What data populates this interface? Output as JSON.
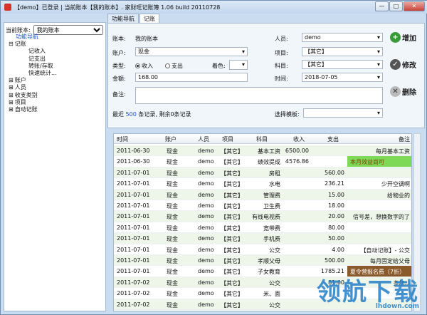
{
  "title": "【demo】已登录 | 当前账本【我的账本】. 家财旺记账簿 1.06 build 20110728",
  "window_buttons": {
    "min": "—",
    "max": "□",
    "close": "✕"
  },
  "left": {
    "acct_label": "当前账本:",
    "acct_value": "我的账本",
    "tree": [
      {
        "label": "功能导航",
        "level": 0,
        "selected": true,
        "toggle": ""
      },
      {
        "label": "记账",
        "level": 0,
        "toggle": "⊟"
      },
      {
        "label": "记收入",
        "level": 1
      },
      {
        "label": "记支出",
        "level": 1
      },
      {
        "label": "转账/存取",
        "level": 1
      },
      {
        "label": "快速统计...",
        "level": 1
      },
      {
        "label": "账户",
        "level": 0,
        "toggle": "⊞"
      },
      {
        "label": "人员",
        "level": 0,
        "toggle": "⊞"
      },
      {
        "label": "收支类别",
        "level": 0,
        "toggle": "⊞"
      },
      {
        "label": "项目",
        "level": 0,
        "toggle": "⊞"
      },
      {
        "label": "自动记账",
        "level": 0,
        "toggle": "⊞"
      }
    ]
  },
  "tabs": [
    "功能导航",
    "记账"
  ],
  "form": {
    "book_label": "账本:",
    "book_value": "我的账本",
    "account_label": "账户:",
    "account_value": "现金",
    "type_label": "类型:",
    "type_income": "收入",
    "type_expense": "支出",
    "color_label": "着色:",
    "amount_label": "金额:",
    "amount_value": "168.00",
    "note_label": "备注:",
    "person_label": "人员:",
    "person_value": "demo",
    "project_label": "项目:",
    "project_value": "【其它】",
    "subject_label": "科目:",
    "subject_value": "【其它】",
    "time_label": "时间:",
    "time_value": "2018-07-05",
    "recent_prefix": "最近",
    "recent_count": "500",
    "recent_suffix": "条记录, 剩余0条记录",
    "template_label": "选择模板:"
  },
  "actions": {
    "add": "增加",
    "edit": "修改",
    "delete": "删除"
  },
  "table": {
    "headers": [
      "时间",
      "账户",
      "人员",
      "项目",
      "科目",
      "收入",
      "支出",
      "备注"
    ],
    "rows": [
      [
        "2011-06-30",
        "现金",
        "demo",
        "【其它】",
        "基本工资",
        "6500.00",
        "",
        "每月基本工资"
      ],
      [
        "2011-06-30",
        "现金",
        "demo",
        "【其它】",
        "绩效提成",
        "4576.86",
        "",
        "本月效益尚可"
      ],
      [
        "2011-07-01",
        "现金",
        "demo",
        "【其它】",
        "房租",
        "",
        "560.00",
        ""
      ],
      [
        "2011-07-01",
        "现金",
        "demo",
        "【其它】",
        "水电",
        "",
        "236.21",
        "少开空调啊"
      ],
      [
        "2011-07-01",
        "现金",
        "demo",
        "【其它】",
        "管理费",
        "",
        "15.00",
        "给物业的"
      ],
      [
        "2011-07-01",
        "现金",
        "demo",
        "【其它】",
        "卫生费",
        "",
        "18.00",
        ""
      ],
      [
        "2011-07-01",
        "现金",
        "demo",
        "【其它】",
        "有线电视费",
        "",
        "20.00",
        "信号差，想换数字的了"
      ],
      [
        "2011-07-01",
        "现金",
        "demo",
        "【其它】",
        "宽带费",
        "",
        "80.00",
        ""
      ],
      [
        "2011-07-01",
        "现金",
        "demo",
        "【其它】",
        "手机费",
        "",
        "50.00",
        ""
      ],
      [
        "2011-07-01",
        "现金",
        "demo",
        "【其它】",
        "公交",
        "",
        "4.00",
        "【自动记账】- 公交"
      ],
      [
        "2011-07-01",
        "现金",
        "demo",
        "【其它】",
        "孝顺父母",
        "",
        "500.00",
        "每月固定给父母"
      ],
      [
        "2011-07-01",
        "现金",
        "demo",
        "【其它】",
        "子女教育",
        "",
        "1785.21",
        "夏令营报名费（7折）"
      ],
      [
        "2011-07-02",
        "现金",
        "demo",
        "【其它】",
        "公交",
        "",
        "81.00",
        "多加..."
      ],
      [
        "2011-07-02",
        "现金",
        "demo",
        "【其它】",
        "米、面",
        "",
        "",
        ""
      ],
      [
        "2011-07-02",
        "现金",
        "demo",
        "【其它】",
        "公交",
        "",
        "",
        ""
      ]
    ]
  },
  "watermark": {
    "text": "领航下载",
    "site": "lhdown.com"
  },
  "colors": {
    "highlight_green": "#7ed957",
    "highlight_brown": "#8b5a2b",
    "accent_blue": "#2f86c9"
  }
}
